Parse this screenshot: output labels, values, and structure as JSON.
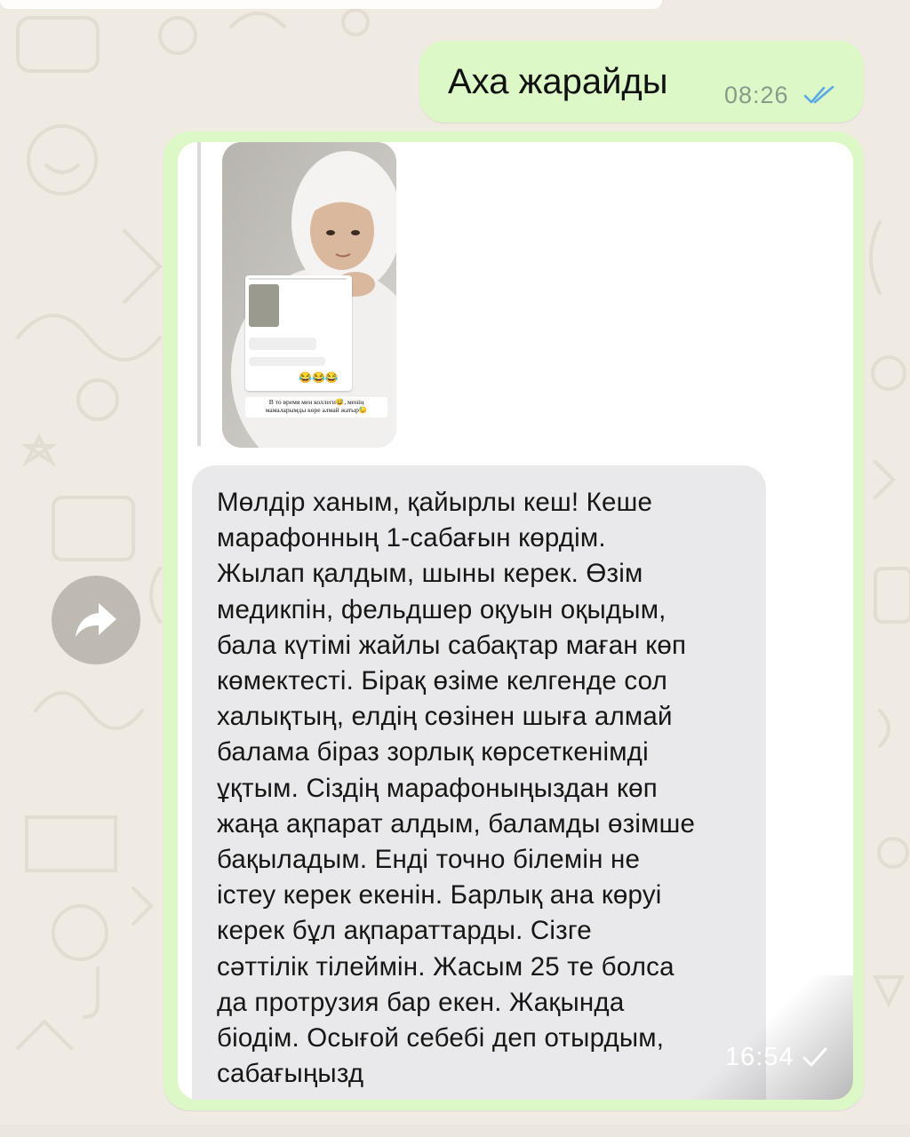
{
  "chat": {
    "messages": [
      {
        "type": "outgoing-text",
        "text": "Аха жарайды",
        "time": "08:26",
        "status": "read"
      },
      {
        "type": "outgoing-media",
        "media": {
          "story_caption_lines": [
            "В то время мен коллеги😅, менің",
            "мамаларымды көре алмай жатыр😓"
          ]
        },
        "text": "Мөлдір ханым, қайырлы кеш! Кеше\nмарафонның 1-сабағын көрдім.\nЖылап қалдым, шыны керек. Өзім\nмедикпін, фельдшер оқуын оқыдым,\nбала күтімі жайлы сабақтар маған көп\nкөмектесті. Бірақ өзіме келгенде сол\nхалықтың, елдің сөзінен шыға алмай\nбалама біраз зорлық көрсеткенімді\nұқтым. Сіздің марафоныңыздан көп\nжаңа ақпарат алдым, баламды өзімше\nбақыладым. Енді точно білемін не\nістеу керек екенін. Барлық ана көруі\nкерек бұл ақпараттарды. Сізге\nсәттілік тілеймін. Жасым 25 те болса\nда протрузия бар екен. Жақында\nбіодім. Осығой себебі деп отырдым,\nсабағыңызд",
        "time": "16:54",
        "status": "sent"
      }
    ]
  },
  "colors": {
    "outgoing_bubble": "#dcf8c6",
    "read_ticks": "#5aa8e8",
    "chat_background": "#efeae2",
    "text_card": "#e9e9eb"
  },
  "icons": {
    "forward": "forward-arrow-icon",
    "read": "double-check-icon",
    "sent": "single-check-icon"
  }
}
